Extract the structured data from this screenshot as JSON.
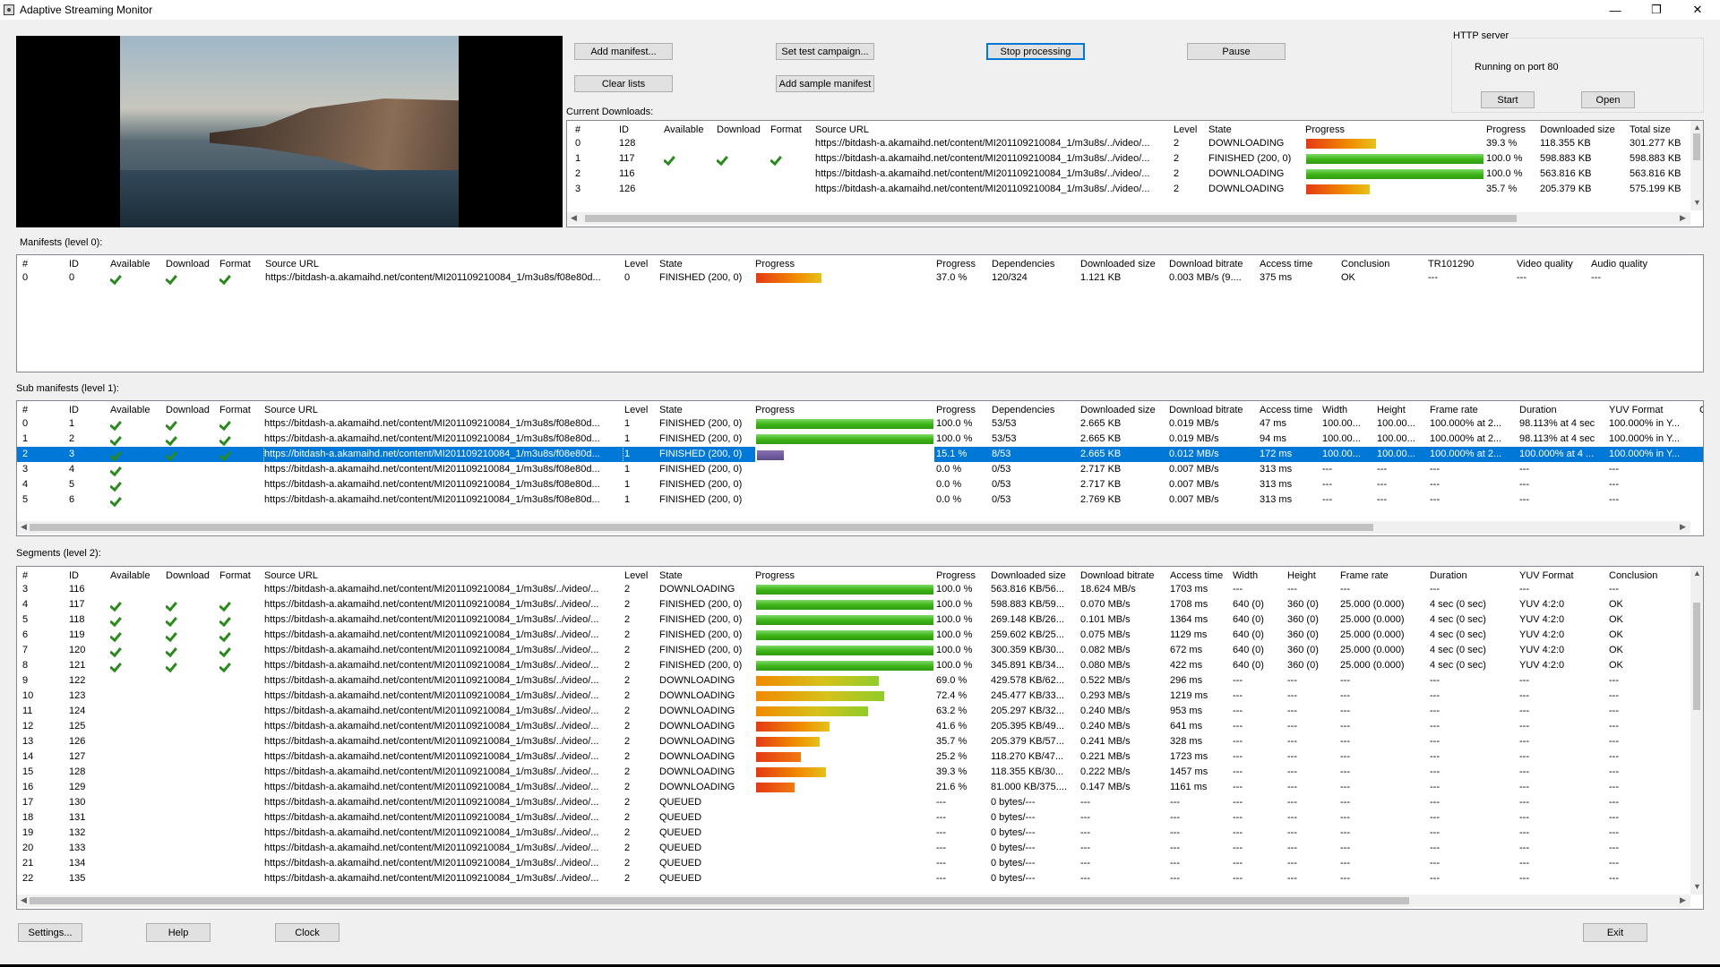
{
  "window": {
    "title": "Adaptive Streaming Monitor",
    "min": "—",
    "max": "❐",
    "close": "✕"
  },
  "buttons": {
    "add_manifest": "Add manifest...",
    "set_test_campaign": "Set test campaign...",
    "stop_processing": "Stop processing",
    "pause": "Pause",
    "clear_lists": "Clear lists",
    "add_sample_manifest": "Add sample manifest",
    "settings": "Settings...",
    "help": "Help",
    "clock": "Clock",
    "exit": "Exit"
  },
  "http_server": {
    "label": "HTTP server",
    "status": "Running on port 80",
    "start": "Start",
    "open": "Open"
  },
  "current_downloads": {
    "label": "Current Downloads:",
    "headers": [
      "#",
      "ID",
      "Available",
      "Download",
      "Format",
      "Source URL",
      "Level",
      "State",
      "Progress",
      "Progress",
      "Downloaded size",
      "Total size"
    ],
    "rows": [
      {
        "n": "0",
        "id": "128",
        "chk": [
          false,
          false,
          false
        ],
        "url": "https://bitdash-a.akamaihd.net/content/MI201109210084_1/m3u8s/../video/...",
        "level": "2",
        "state": "DOWNLOADING",
        "progress": 0.393,
        "pct": "39.3 %",
        "dl": "118.355 KB",
        "total": "301.277 KB"
      },
      {
        "n": "1",
        "id": "117",
        "chk": [
          true,
          true,
          true
        ],
        "url": "https://bitdash-a.akamaihd.net/content/MI201109210084_1/m3u8s/../video/...",
        "level": "2",
        "state": "FINISHED (200, 0)",
        "progress": 1.0,
        "pct": "100.0 %",
        "dl": "598.883 KB",
        "total": "598.883 KB"
      },
      {
        "n": "2",
        "id": "116",
        "chk": [
          false,
          false,
          false
        ],
        "url": "https://bitdash-a.akamaihd.net/content/MI201109210084_1/m3u8s/../video/...",
        "level": "2",
        "state": "DOWNLOADING",
        "progress": 1.0,
        "pct": "100.0 %",
        "dl": "563.816 KB",
        "total": "563.816 KB"
      },
      {
        "n": "3",
        "id": "126",
        "chk": [
          false,
          false,
          false
        ],
        "url": "https://bitdash-a.akamaihd.net/content/MI201109210084_1/m3u8s/../video/...",
        "level": "2",
        "state": "DOWNLOADING",
        "progress": 0.357,
        "pct": "35.7 %",
        "dl": "205.379 KB",
        "total": "575.199 KB"
      }
    ]
  },
  "manifests": {
    "label": "Manifests (level 0):",
    "headers": [
      "#",
      "ID",
      "Available",
      "Download",
      "Format",
      "Source URL",
      "Level",
      "State",
      "Progress",
      "Progress",
      "Dependencies",
      "Downloaded size",
      "Download bitrate",
      "Access time",
      "Conclusion",
      "TR101290",
      "Video quality",
      "Audio quality"
    ],
    "rows": [
      {
        "n": "0",
        "id": "0",
        "chk": [
          true,
          true,
          true
        ],
        "url": "https://bitdash-a.akamaihd.net/content/MI201109210084_1/m3u8s/f08e80d...",
        "level": "0",
        "state": "FINISHED (200, 0)",
        "progress": 0.37,
        "pct": "37.0 %",
        "deps": "120/324",
        "dl": "1.121 KB",
        "bitrate": "0.003 MB/s (9....",
        "access": "375 ms",
        "conclusion": "OK",
        "tr": "---",
        "vq": "---",
        "aq": "---"
      }
    ]
  },
  "sub_manifests": {
    "label": "Sub manifests (level 1):",
    "headers": [
      "#",
      "ID",
      "Available",
      "Download",
      "Format",
      "Source URL",
      "Level",
      "State",
      "Progress",
      "Progress",
      "Dependencies",
      "Downloaded size",
      "Download bitrate",
      "Access time",
      "Width",
      "Height",
      "Frame rate",
      "Duration",
      "YUV Format",
      "C"
    ],
    "rows": [
      {
        "n": "0",
        "id": "1",
        "chk": [
          true,
          true,
          true
        ],
        "url": "https://bitdash-a.akamaihd.net/content/MI201109210084_1/m3u8s/f08e80d...",
        "level": "1",
        "state": "FINISHED (200, 0)",
        "progress": 1.0,
        "pct": "100.0 %",
        "deps": "53/53",
        "dl": "2.665 KB",
        "bitrate": "0.019 MB/s",
        "access": "47 ms",
        "w": "100.00...",
        "h": "100.00...",
        "fr": "100.000% at 2...",
        "dur": "98.113% at 4 sec",
        "yuv": "100.000% in Y..."
      },
      {
        "n": "1",
        "id": "2",
        "chk": [
          true,
          true,
          true
        ],
        "url": "https://bitdash-a.akamaihd.net/content/MI201109210084_1/m3u8s/f08e80d...",
        "level": "1",
        "state": "FINISHED (200, 0)",
        "progress": 1.0,
        "pct": "100.0 %",
        "deps": "53/53",
        "dl": "2.665 KB",
        "bitrate": "0.019 MB/s",
        "access": "94 ms",
        "w": "100.00...",
        "h": "100.00...",
        "fr": "100.000% at 2...",
        "dur": "98.113% at 4 sec",
        "yuv": "100.000% in Y..."
      },
      {
        "n": "2",
        "id": "3",
        "chk": [
          true,
          true,
          true
        ],
        "url": "https://bitdash-a.akamaihd.net/content/MI201109210084_1/m3u8s/f08e80d...",
        "level": "1",
        "state": "FINISHED (200, 0)",
        "progress": 0.151,
        "pct": "15.1 %",
        "deps": "8/53",
        "dl": "2.665 KB",
        "bitrate": "0.012 MB/s",
        "access": "172 ms",
        "w": "100.00...",
        "h": "100.00...",
        "fr": "100.000% at 2...",
        "dur": "100.000% at 4 ...",
        "yuv": "100.000% in Y...",
        "selected": true
      },
      {
        "n": "3",
        "id": "4",
        "chk": [
          true,
          false,
          false
        ],
        "url": "https://bitdash-a.akamaihd.net/content/MI201109210084_1/m3u8s/f08e80d...",
        "level": "1",
        "state": "FINISHED (200, 0)",
        "progress": 0,
        "pct": "0.0 %",
        "deps": "0/53",
        "dl": "2.717 KB",
        "bitrate": "0.007 MB/s",
        "access": "313 ms",
        "w": "---",
        "h": "---",
        "fr": "---",
        "dur": "---",
        "yuv": "---"
      },
      {
        "n": "4",
        "id": "5",
        "chk": [
          true,
          false,
          false
        ],
        "url": "https://bitdash-a.akamaihd.net/content/MI201109210084_1/m3u8s/f08e80d...",
        "level": "1",
        "state": "FINISHED (200, 0)",
        "progress": 0,
        "pct": "0.0 %",
        "deps": "0/53",
        "dl": "2.717 KB",
        "bitrate": "0.007 MB/s",
        "access": "313 ms",
        "w": "---",
        "h": "---",
        "fr": "---",
        "dur": "---",
        "yuv": "---"
      },
      {
        "n": "5",
        "id": "6",
        "chk": [
          true,
          false,
          false
        ],
        "url": "https://bitdash-a.akamaihd.net/content/MI201109210084_1/m3u8s/f08e80d...",
        "level": "1",
        "state": "FINISHED (200, 0)",
        "progress": 0,
        "pct": "0.0 %",
        "deps": "0/53",
        "dl": "2.769 KB",
        "bitrate": "0.007 MB/s",
        "access": "313 ms",
        "w": "---",
        "h": "---",
        "fr": "---",
        "dur": "---",
        "yuv": "---"
      }
    ]
  },
  "segments": {
    "label": "Segments (level 2):",
    "headers": [
      "#",
      "ID",
      "Available",
      "Download",
      "Format",
      "Source URL",
      "Level",
      "State",
      "Progress",
      "Progress",
      "Downloaded size",
      "Download bitrate",
      "Access time",
      "Width",
      "Height",
      "Frame rate",
      "Duration",
      "YUV Format",
      "Conclusion"
    ],
    "rows": [
      {
        "n": "3",
        "id": "116",
        "chk": [
          false,
          false,
          false
        ],
        "url": "https://bitdash-a.akamaihd.net/content/MI201109210084_1/m3u8s/../video/...",
        "level": "2",
        "state": "DOWNLOADING",
        "progress": 1.0,
        "pct": "100.0 %",
        "dl": "563.816 KB/56...",
        "bitrate": "18.624 MB/s",
        "access": "1703 ms",
        "w": "---",
        "h": "---",
        "fr": "---",
        "dur": "---",
        "yuv": "---",
        "conc": "---"
      },
      {
        "n": "4",
        "id": "117",
        "chk": [
          true,
          true,
          true
        ],
        "url": "https://bitdash-a.akamaihd.net/content/MI201109210084_1/m3u8s/../video/...",
        "level": "2",
        "state": "FINISHED (200, 0)",
        "progress": 1.0,
        "pct": "100.0 %",
        "dl": "598.883 KB/59...",
        "bitrate": "0.070 MB/s",
        "access": "1708 ms",
        "w": "640 (0)",
        "h": "360 (0)",
        "fr": "25.000 (0.000)",
        "dur": "4 sec (0 sec)",
        "yuv": "YUV 4:2:0",
        "conc": "OK"
      },
      {
        "n": "5",
        "id": "118",
        "chk": [
          true,
          true,
          true
        ],
        "url": "https://bitdash-a.akamaihd.net/content/MI201109210084_1/m3u8s/../video/...",
        "level": "2",
        "state": "FINISHED (200, 0)",
        "progress": 1.0,
        "pct": "100.0 %",
        "dl": "269.148 KB/26...",
        "bitrate": "0.101 MB/s",
        "access": "1364 ms",
        "w": "640 (0)",
        "h": "360 (0)",
        "fr": "25.000 (0.000)",
        "dur": "4 sec (0 sec)",
        "yuv": "YUV 4:2:0",
        "conc": "OK"
      },
      {
        "n": "6",
        "id": "119",
        "chk": [
          true,
          true,
          true
        ],
        "url": "https://bitdash-a.akamaihd.net/content/MI201109210084_1/m3u8s/../video/...",
        "level": "2",
        "state": "FINISHED (200, 0)",
        "progress": 1.0,
        "pct": "100.0 %",
        "dl": "259.602 KB/25...",
        "bitrate": "0.075 MB/s",
        "access": "1129 ms",
        "w": "640 (0)",
        "h": "360 (0)",
        "fr": "25.000 (0.000)",
        "dur": "4 sec (0 sec)",
        "yuv": "YUV 4:2:0",
        "conc": "OK"
      },
      {
        "n": "7",
        "id": "120",
        "chk": [
          true,
          true,
          true
        ],
        "url": "https://bitdash-a.akamaihd.net/content/MI201109210084_1/m3u8s/../video/...",
        "level": "2",
        "state": "FINISHED (200, 0)",
        "progress": 1.0,
        "pct": "100.0 %",
        "dl": "300.359 KB/30...",
        "bitrate": "0.082 MB/s",
        "access": "672 ms",
        "w": "640 (0)",
        "h": "360 (0)",
        "fr": "25.000 (0.000)",
        "dur": "4 sec (0 sec)",
        "yuv": "YUV 4:2:0",
        "conc": "OK"
      },
      {
        "n": "8",
        "id": "121",
        "chk": [
          true,
          true,
          true
        ],
        "url": "https://bitdash-a.akamaihd.net/content/MI201109210084_1/m3u8s/../video/...",
        "level": "2",
        "state": "FINISHED (200, 0)",
        "progress": 1.0,
        "pct": "100.0 %",
        "dl": "345.891 KB/34...",
        "bitrate": "0.080 MB/s",
        "access": "422 ms",
        "w": "640 (0)",
        "h": "360 (0)",
        "fr": "25.000 (0.000)",
        "dur": "4 sec (0 sec)",
        "yuv": "YUV 4:2:0",
        "conc": "OK"
      },
      {
        "n": "9",
        "id": "122",
        "chk": [
          false,
          false,
          false
        ],
        "url": "https://bitdash-a.akamaihd.net/content/MI201109210084_1/m3u8s/../video/...",
        "level": "2",
        "state": "DOWNLOADING",
        "progress": 0.69,
        "pct": "69.0 %",
        "dl": "429.578 KB/62...",
        "bitrate": "0.522 MB/s",
        "access": "296 ms",
        "w": "---",
        "h": "---",
        "fr": "---",
        "dur": "---",
        "yuv": "---",
        "conc": "---"
      },
      {
        "n": "10",
        "id": "123",
        "chk": [
          false,
          false,
          false
        ],
        "url": "https://bitdash-a.akamaihd.net/content/MI201109210084_1/m3u8s/../video/...",
        "level": "2",
        "state": "DOWNLOADING",
        "progress": 0.724,
        "pct": "72.4 %",
        "dl": "245.477 KB/33...",
        "bitrate": "0.293 MB/s",
        "access": "1219 ms",
        "w": "---",
        "h": "---",
        "fr": "---",
        "dur": "---",
        "yuv": "---",
        "conc": "---"
      },
      {
        "n": "11",
        "id": "124",
        "chk": [
          false,
          false,
          false
        ],
        "url": "https://bitdash-a.akamaihd.net/content/MI201109210084_1/m3u8s/../video/...",
        "level": "2",
        "state": "DOWNLOADING",
        "progress": 0.632,
        "pct": "63.2 %",
        "dl": "205.297 KB/32...",
        "bitrate": "0.240 MB/s",
        "access": "953 ms",
        "w": "---",
        "h": "---",
        "fr": "---",
        "dur": "---",
        "yuv": "---",
        "conc": "---"
      },
      {
        "n": "12",
        "id": "125",
        "chk": [
          false,
          false,
          false
        ],
        "url": "https://bitdash-a.akamaihd.net/content/MI201109210084_1/m3u8s/../video/...",
        "level": "2",
        "state": "DOWNLOADING",
        "progress": 0.416,
        "pct": "41.6 %",
        "dl": "205.395 KB/49...",
        "bitrate": "0.240 MB/s",
        "access": "641 ms",
        "w": "---",
        "h": "---",
        "fr": "---",
        "dur": "---",
        "yuv": "---",
        "conc": "---"
      },
      {
        "n": "13",
        "id": "126",
        "chk": [
          false,
          false,
          false
        ],
        "url": "https://bitdash-a.akamaihd.net/content/MI201109210084_1/m3u8s/../video/...",
        "level": "2",
        "state": "DOWNLOADING",
        "progress": 0.357,
        "pct": "35.7 %",
        "dl": "205.379 KB/57...",
        "bitrate": "0.241 MB/s",
        "access": "328 ms",
        "w": "---",
        "h": "---",
        "fr": "---",
        "dur": "---",
        "yuv": "---",
        "conc": "---"
      },
      {
        "n": "14",
        "id": "127",
        "chk": [
          false,
          false,
          false
        ],
        "url": "https://bitdash-a.akamaihd.net/content/MI201109210084_1/m3u8s/../video/...",
        "level": "2",
        "state": "DOWNLOADING",
        "progress": 0.252,
        "pct": "25.2 %",
        "dl": "118.270 KB/47...",
        "bitrate": "0.221 MB/s",
        "access": "1723 ms",
        "w": "---",
        "h": "---",
        "fr": "---",
        "dur": "---",
        "yuv": "---",
        "conc": "---"
      },
      {
        "n": "15",
        "id": "128",
        "chk": [
          false,
          false,
          false
        ],
        "url": "https://bitdash-a.akamaihd.net/content/MI201109210084_1/m3u8s/../video/...",
        "level": "2",
        "state": "DOWNLOADING",
        "progress": 0.393,
        "pct": "39.3 %",
        "dl": "118.355 KB/30...",
        "bitrate": "0.222 MB/s",
        "access": "1457 ms",
        "w": "---",
        "h": "---",
        "fr": "---",
        "dur": "---",
        "yuv": "---",
        "conc": "---"
      },
      {
        "n": "16",
        "id": "129",
        "chk": [
          false,
          false,
          false
        ],
        "url": "https://bitdash-a.akamaihd.net/content/MI201109210084_1/m3u8s/../video/...",
        "level": "2",
        "state": "DOWNLOADING",
        "progress": 0.216,
        "pct": "21.6 %",
        "dl": "81.000 KB/375....",
        "bitrate": "0.147 MB/s",
        "access": "1161 ms",
        "w": "---",
        "h": "---",
        "fr": "---",
        "dur": "---",
        "yuv": "---",
        "conc": "---"
      },
      {
        "n": "17",
        "id": "130",
        "chk": [
          false,
          false,
          false
        ],
        "url": "https://bitdash-a.akamaihd.net/content/MI201109210084_1/m3u8s/../video/...",
        "level": "2",
        "state": "QUEUED",
        "progress": 0,
        "pct": "---",
        "dl": "0 bytes/---",
        "bitrate": "---",
        "access": "---",
        "w": "---",
        "h": "---",
        "fr": "---",
        "dur": "---",
        "yuv": "---",
        "conc": "---"
      },
      {
        "n": "18",
        "id": "131",
        "chk": [
          false,
          false,
          false
        ],
        "url": "https://bitdash-a.akamaihd.net/content/MI201109210084_1/m3u8s/../video/...",
        "level": "2",
        "state": "QUEUED",
        "progress": 0,
        "pct": "---",
        "dl": "0 bytes/---",
        "bitrate": "---",
        "access": "---",
        "w": "---",
        "h": "---",
        "fr": "---",
        "dur": "---",
        "yuv": "---",
        "conc": "---"
      },
      {
        "n": "19",
        "id": "132",
        "chk": [
          false,
          false,
          false
        ],
        "url": "https://bitdash-a.akamaihd.net/content/MI201109210084_1/m3u8s/../video/...",
        "level": "2",
        "state": "QUEUED",
        "progress": 0,
        "pct": "---",
        "dl": "0 bytes/---",
        "bitrate": "---",
        "access": "---",
        "w": "---",
        "h": "---",
        "fr": "---",
        "dur": "---",
        "yuv": "---",
        "conc": "---"
      },
      {
        "n": "20",
        "id": "133",
        "chk": [
          false,
          false,
          false
        ],
        "url": "https://bitdash-a.akamaihd.net/content/MI201109210084_1/m3u8s/../video/...",
        "level": "2",
        "state": "QUEUED",
        "progress": 0,
        "pct": "---",
        "dl": "0 bytes/---",
        "bitrate": "---",
        "access": "---",
        "w": "---",
        "h": "---",
        "fr": "---",
        "dur": "---",
        "yuv": "---",
        "conc": "---"
      },
      {
        "n": "21",
        "id": "134",
        "chk": [
          false,
          false,
          false
        ],
        "url": "https://bitdash-a.akamaihd.net/content/MI201109210084_1/m3u8s/../video/...",
        "level": "2",
        "state": "QUEUED",
        "progress": 0,
        "pct": "---",
        "dl": "0 bytes/---",
        "bitrate": "---",
        "access": "---",
        "w": "---",
        "h": "---",
        "fr": "---",
        "dur": "---",
        "yuv": "---",
        "conc": "---"
      },
      {
        "n": "22",
        "id": "135",
        "chk": [
          false,
          false,
          false
        ],
        "url": "https://bitdash-a.akamaihd.net/content/MI201109210084_1/m3u8s/../video/...",
        "level": "2",
        "state": "QUEUED",
        "progress": 0,
        "pct": "---",
        "dl": "0 bytes/---",
        "bitrate": "---",
        "access": "---",
        "w": "---",
        "h": "---",
        "fr": "---",
        "dur": "---",
        "yuv": "---",
        "conc": "---"
      }
    ]
  },
  "colors": {
    "selection": "#0078d7",
    "check": "#2b8a1e",
    "progress_green": "#3fb618",
    "progress_orange": "#f08a00",
    "progress_red": "#e53a14"
  }
}
